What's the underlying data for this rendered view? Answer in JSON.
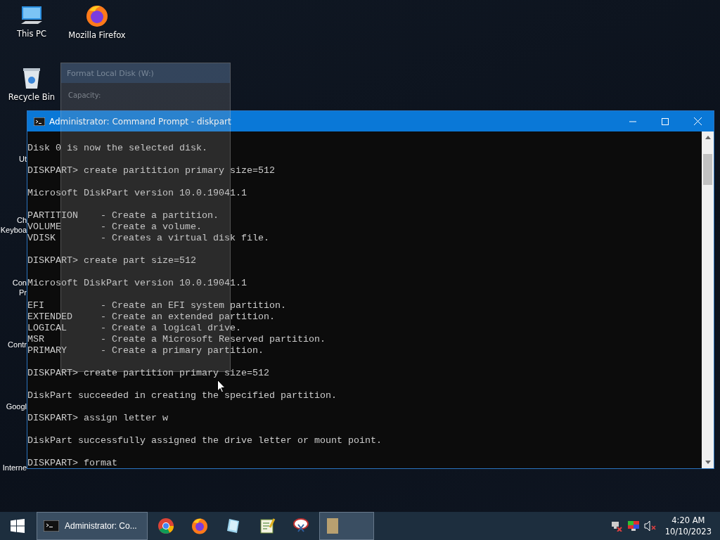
{
  "desktop_icons": [
    {
      "kind": "pc",
      "label": "This PC"
    },
    {
      "kind": "firefox",
      "label": "Mozilla Firefox"
    },
    {
      "kind": "bin",
      "label": "Recycle Bin"
    }
  ],
  "hidden_icon_labels": [
    [
      "Ut"
    ],
    [
      "Ch",
      "Keyboa"
    ],
    [
      "Con",
      "Pr"
    ],
    [
      "Contr"
    ],
    [
      "Googl"
    ],
    [
      "Interne"
    ]
  ],
  "ghost_dialog": {
    "title": "Format Local Disk (W:)",
    "capacity_label": "Capacity:"
  },
  "window": {
    "title": "Administrator: Command Prompt - diskpart",
    "blocks": [
      [
        "Disk 0 is now the selected disk."
      ],
      [
        "DISKPART> create paritition primary size=512"
      ],
      [
        "Microsoft DiskPart version 10.0.19041.1"
      ],
      [
        "PARTITION    - Create a partition.",
        "VOLUME       - Create a volume.",
        "VDISK        - Creates a virtual disk file."
      ],
      [
        "DISKPART> create part size=512"
      ],
      [
        "Microsoft DiskPart version 10.0.19041.1"
      ],
      [
        "EFI          - Create an EFI system partition.",
        "EXTENDED     - Create an extended partition.",
        "LOGICAL      - Create a logical drive.",
        "MSR          - Create a Microsoft Reserved partition.",
        "PRIMARY      - Create a primary partition."
      ],
      [
        "DISKPART> create partition primary size=512"
      ],
      [
        "DiskPart succeeded in creating the specified partition."
      ],
      [
        "DISKPART> assign letter w"
      ],
      [
        "DiskPart successfully assigned the drive letter or mount point."
      ],
      [
        "DISKPART> format"
      ]
    ]
  },
  "taskbar": {
    "items": [
      {
        "kind": "cmd",
        "label": "Administrator: Co...",
        "active": true
      },
      {
        "kind": "chrome",
        "active": false
      },
      {
        "kind": "firefox",
        "active": false
      },
      {
        "kind": "notepad",
        "active": false
      },
      {
        "kind": "editor",
        "active": false
      },
      {
        "kind": "snip",
        "active": false
      },
      {
        "kind": "folder",
        "active": true
      }
    ],
    "time": "4:20 AM",
    "date": "10/10/2023"
  }
}
